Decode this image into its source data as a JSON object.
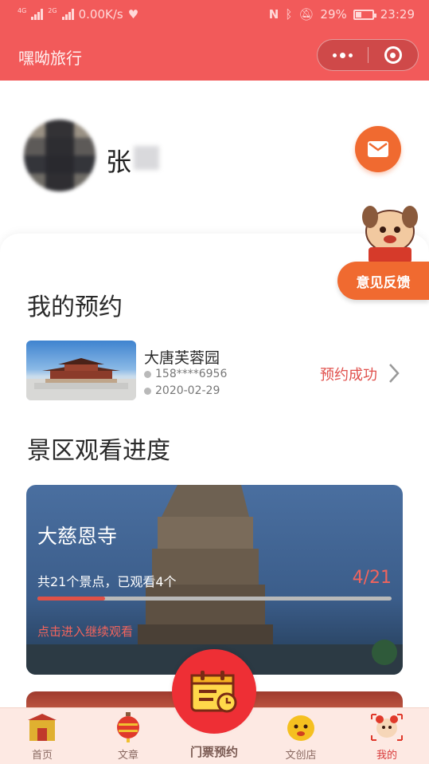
{
  "status_bar": {
    "net_1": "4G",
    "net_2": "2G",
    "speed": "0.00K/s",
    "battery": "29%",
    "time": "23:29"
  },
  "titlebar": {
    "title": "嘿呦旅行"
  },
  "profile": {
    "name": "张"
  },
  "sections": {
    "bookings_title": "我的预约",
    "progress_title": "景区观看进度"
  },
  "booking": {
    "name": "大唐芙蓉园",
    "phone": "158****6956",
    "date": "2020-02-29",
    "status": "预约成功"
  },
  "progress_card": {
    "title": "大慈恩寺",
    "info": "共21个景点，已观看4个",
    "count_text": "4/21",
    "watched": 4,
    "total": 21,
    "link": "点击进入继续观看"
  },
  "feedback": {
    "label": "意见反馈"
  },
  "tabbar": {
    "home": "首页",
    "articles": "文章",
    "tickets": "门票预约",
    "shop": "文创店",
    "mine": "我的"
  },
  "colors": {
    "header": "#f25a5a",
    "accent": "#f06a30",
    "status_red": "#e0504c",
    "tab_bg": "#fde9e3",
    "center_tab": "#ee2f35"
  }
}
